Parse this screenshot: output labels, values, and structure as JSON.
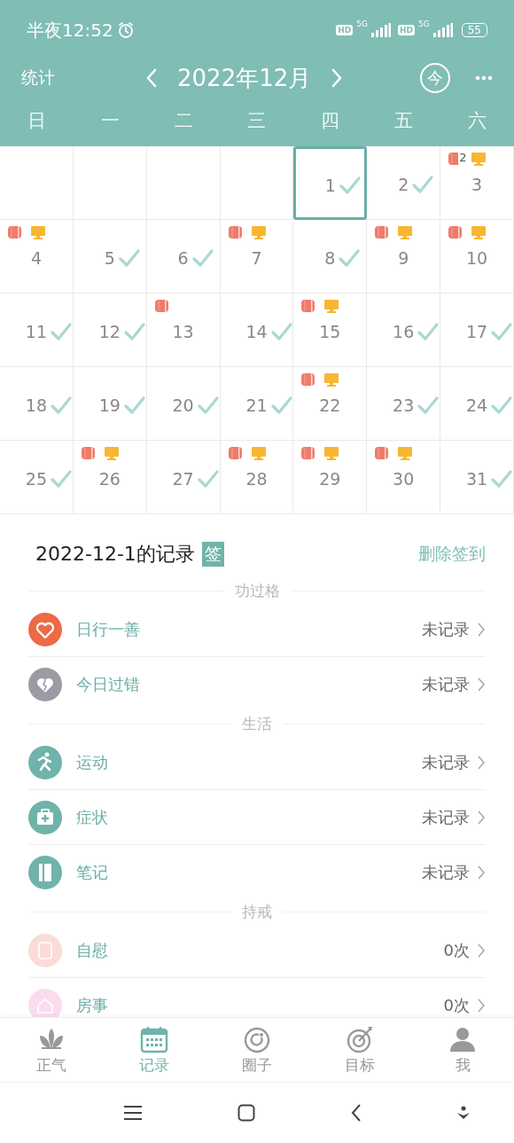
{
  "status_bar": {
    "time": "半夜12:52",
    "sims": [
      {
        "hd": "HD",
        "network": "5G"
      },
      {
        "hd": "HD",
        "network": "5G"
      }
    ],
    "battery": "55"
  },
  "header": {
    "stats": "统计",
    "month": "2022年12月",
    "today": "今"
  },
  "weekdays": [
    "日",
    "一",
    "二",
    "三",
    "四",
    "五",
    "六"
  ],
  "calendar": {
    "weeks": [
      [
        {
          "day": "1",
          "checked": true,
          "roll_icon": false,
          "screen_icon": false,
          "selected": true
        },
        {
          "day": "2",
          "checked": true,
          "roll_icon": false,
          "screen_icon": false,
          "selected": false
        },
        {
          "day": "3",
          "checked": false,
          "roll_icon": true,
          "roll_count": "2",
          "screen_icon": true,
          "selected": false
        }
      ],
      [
        {
          "day": "4",
          "checked": false,
          "roll_icon": true,
          "screen_icon": true,
          "selected": false
        },
        {
          "day": "5",
          "checked": true,
          "roll_icon": false,
          "screen_icon": false,
          "selected": false
        },
        {
          "day": "6",
          "checked": true,
          "roll_icon": false,
          "screen_icon": false,
          "selected": false
        },
        {
          "day": "7",
          "checked": false,
          "roll_icon": true,
          "screen_icon": true,
          "selected": false
        },
        {
          "day": "8",
          "checked": true,
          "roll_icon": false,
          "screen_icon": false,
          "selected": false
        },
        {
          "day": "9",
          "checked": false,
          "roll_icon": true,
          "screen_icon": true,
          "selected": false
        },
        {
          "day": "10",
          "checked": false,
          "roll_icon": true,
          "screen_icon": true,
          "selected": false
        }
      ],
      [
        {
          "day": "11",
          "checked": true,
          "roll_icon": false,
          "screen_icon": false,
          "selected": false
        },
        {
          "day": "12",
          "checked": true,
          "roll_icon": false,
          "screen_icon": false,
          "selected": false
        },
        {
          "day": "13",
          "checked": false,
          "roll_icon": true,
          "screen_icon": false,
          "selected": false
        },
        {
          "day": "14",
          "checked": true,
          "roll_icon": false,
          "screen_icon": false,
          "selected": false
        },
        {
          "day": "15",
          "checked": false,
          "roll_icon": true,
          "screen_icon": true,
          "selected": false
        },
        {
          "day": "16",
          "checked": true,
          "roll_icon": false,
          "screen_icon": false,
          "selected": false
        },
        {
          "day": "17",
          "checked": true,
          "roll_icon": false,
          "screen_icon": false,
          "selected": false
        }
      ],
      [
        {
          "day": "18",
          "checked": true,
          "roll_icon": false,
          "screen_icon": false,
          "selected": false
        },
        {
          "day": "19",
          "checked": true,
          "roll_icon": false,
          "screen_icon": false,
          "selected": false
        },
        {
          "day": "20",
          "checked": true,
          "roll_icon": false,
          "screen_icon": false,
          "selected": false
        },
        {
          "day": "21",
          "checked": true,
          "roll_icon": false,
          "screen_icon": false,
          "selected": false
        },
        {
          "day": "22",
          "checked": false,
          "roll_icon": true,
          "screen_icon": true,
          "selected": false
        },
        {
          "day": "23",
          "checked": true,
          "roll_icon": false,
          "screen_icon": false,
          "selected": false
        },
        {
          "day": "24",
          "checked": true,
          "roll_icon": false,
          "screen_icon": false,
          "selected": false
        }
      ],
      [
        {
          "day": "25",
          "checked": true,
          "roll_icon": false,
          "screen_icon": false,
          "selected": false
        },
        {
          "day": "26",
          "checked": false,
          "roll_icon": true,
          "screen_icon": true,
          "selected": false
        },
        {
          "day": "27",
          "checked": true,
          "roll_icon": false,
          "screen_icon": false,
          "selected": false
        },
        {
          "day": "28",
          "checked": false,
          "roll_icon": true,
          "screen_icon": true,
          "selected": false
        },
        {
          "day": "29",
          "checked": false,
          "roll_icon": true,
          "screen_icon": true,
          "selected": false
        },
        {
          "day": "30",
          "checked": false,
          "roll_icon": true,
          "screen_icon": true,
          "selected": false
        },
        {
          "day": "31",
          "checked": true,
          "roll_icon": false,
          "screen_icon": false,
          "selected": false
        }
      ]
    ]
  },
  "record": {
    "title": "2022-12-1的记录",
    "badge": "签",
    "action": "删除签到",
    "sections": [
      {
        "heading": "功过格",
        "items": [
          {
            "label": "日行一善",
            "value": "未记录",
            "color": "#ec6a48"
          },
          {
            "label": "今日过错",
            "value": "未记录",
            "color": "#9c9aa4"
          }
        ]
      },
      {
        "heading": "生活",
        "items": [
          {
            "label": "运动",
            "value": "未记录",
            "color": "#6fb3aa"
          },
          {
            "label": "症状",
            "value": "未记录",
            "color": "#6fb3aa"
          },
          {
            "label": "笔记",
            "value": "未记录",
            "color": "#6fb3aa"
          }
        ]
      },
      {
        "heading": "持戒",
        "items": [
          {
            "label": "自慰",
            "value": "0次",
            "color": "#fbdcd8"
          },
          {
            "label": "房事",
            "value": "0次",
            "color": "#fadcef"
          }
        ]
      }
    ]
  },
  "tabs": [
    {
      "label": "正气",
      "selected": false
    },
    {
      "label": "记录",
      "selected": true
    },
    {
      "label": "圈子",
      "selected": false
    },
    {
      "label": "目标",
      "selected": false
    },
    {
      "label": "我",
      "selected": false
    }
  ]
}
